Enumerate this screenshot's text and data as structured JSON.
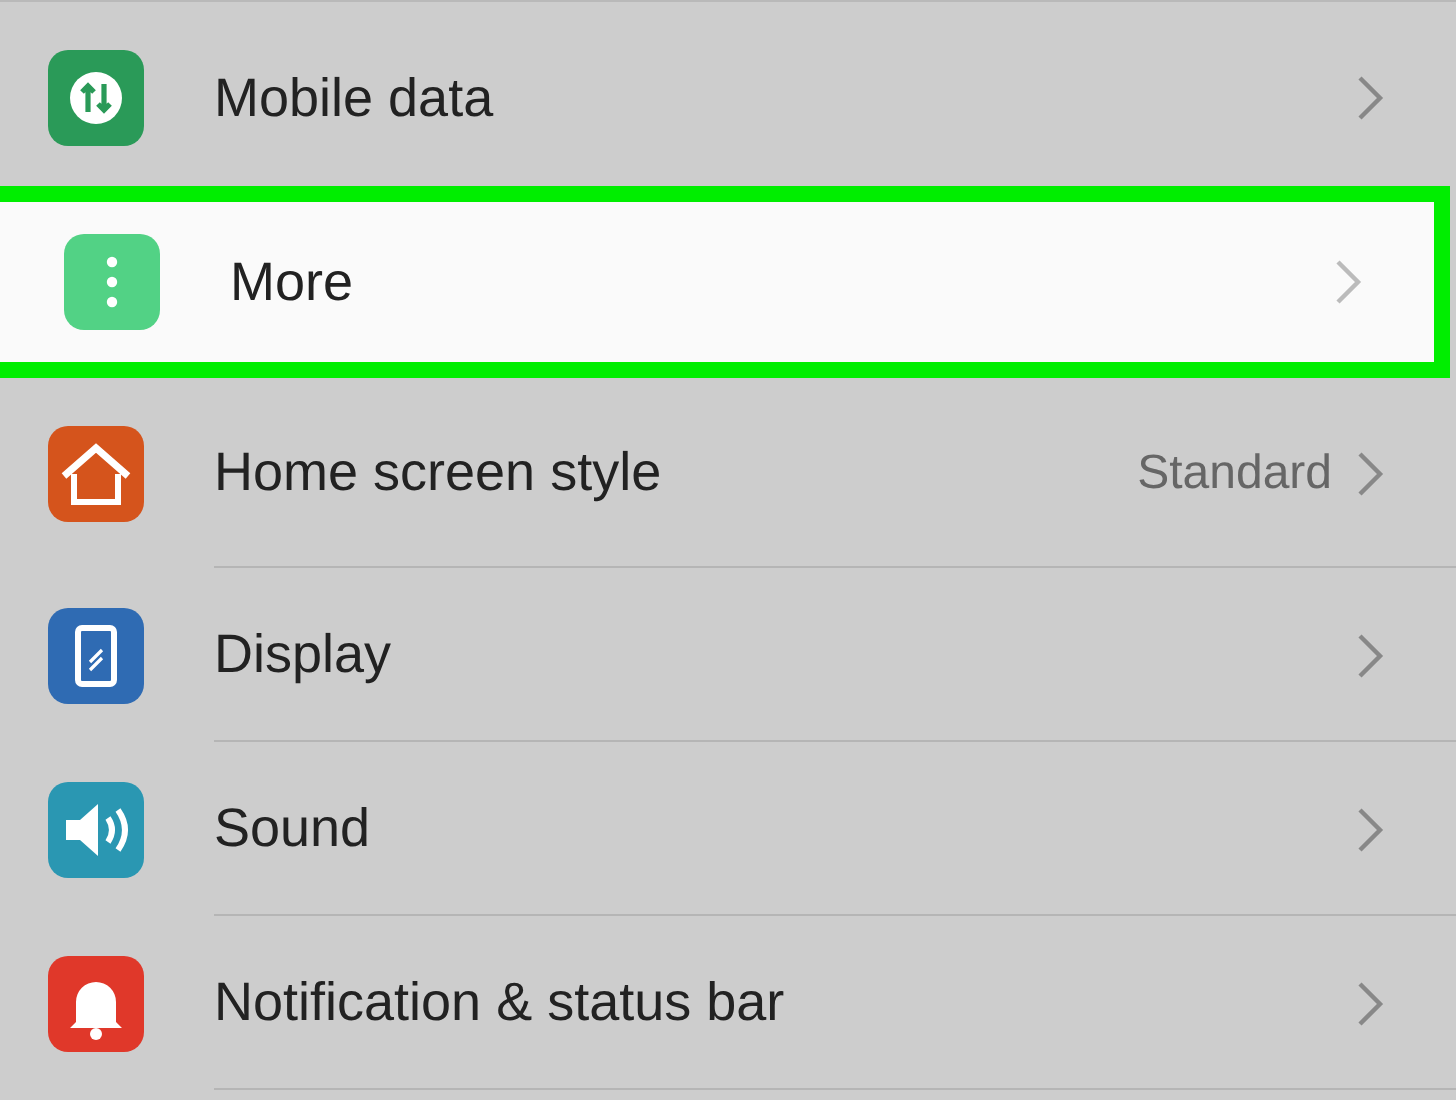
{
  "settings": [
    {
      "label": "Mobile data",
      "kind": "data",
      "highlighted": false
    },
    {
      "label": "More",
      "kind": "more",
      "highlighted": true
    },
    {
      "label": "Home screen style",
      "kind": "home",
      "value": "Standard",
      "highlighted": false
    },
    {
      "label": "Display",
      "kind": "display",
      "highlighted": false
    },
    {
      "label": "Sound",
      "kind": "sound",
      "highlighted": false
    },
    {
      "label": "Notification & status bar",
      "kind": "notification",
      "highlighted": false
    }
  ]
}
